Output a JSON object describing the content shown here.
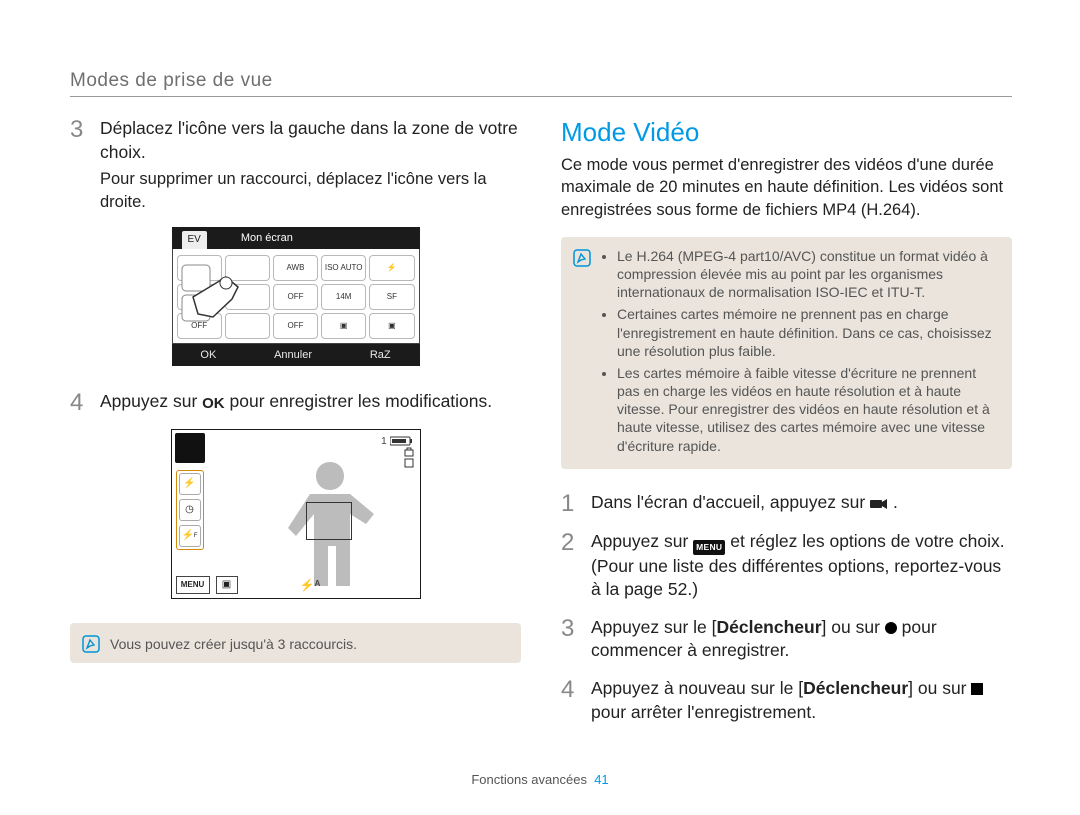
{
  "header": {
    "title": "Modes de prise de vue"
  },
  "left": {
    "step3": {
      "num": "3",
      "text": "Déplacez l'icône vers la gauche dans la zone de votre choix.",
      "sub": "Pour supprimer un raccourci, déplacez l'icône vers la droite."
    },
    "lcd1": {
      "ev_label": "EV",
      "title": "Mon écran",
      "cells": [
        "",
        "",
        "AWB",
        "ISO AUTO",
        "⚡",
        "",
        "",
        "OFF",
        "14M",
        "SF",
        "OFF",
        "",
        "OFF",
        "▣",
        "▣"
      ],
      "ok": "OK",
      "cancel": "Annuler",
      "reset": "RaZ"
    },
    "step4": {
      "num": "4",
      "pre": "Appuyez sur ",
      "ok": "OK",
      "post": " pour enregistrer les modifications."
    },
    "lcd2": {
      "counter": "1",
      "menu": "MENU",
      "flash": "⚡ᴬ"
    },
    "note_bottom": "Vous pouvez créer jusqu'à 3 raccourcis."
  },
  "right": {
    "heading": "Mode Vidéo",
    "desc": "Ce mode vous permet d'enregistrer des vidéos d'une durée maximale de 20 minutes en haute définition. Les vidéos sont enregistrées sous forme de fichiers MP4 (H.264).",
    "notes": [
      "Le H.264 (MPEG-4 part10/AVC) constitue un format vidéo à compression élevée mis au point par les organismes internationaux de normalisation ISO-IEC et ITU-T.",
      "Certaines cartes mémoire ne prennent pas en charge l'enregistrement en haute définition. Dans ce cas, choisissez une résolution plus faible.",
      "Les cartes mémoire à faible vitesse d'écriture ne prennent pas en charge les vidéos en haute résolution et à haute vitesse. Pour enregistrer des vidéos en haute résolution et à haute vitesse, utilisez des cartes mémoire avec une vitesse d'écriture rapide."
    ],
    "step1": {
      "num": "1",
      "pre": "Dans l'écran d'accueil, appuyez sur ",
      "post": "."
    },
    "step2": {
      "num": "2",
      "pre": "Appuyez sur ",
      "menu": "MENU",
      "mid": " et réglez les options de votre choix. (Pour une liste des différentes options, reportez-vous à la page 52.)"
    },
    "step3": {
      "num": "3",
      "pre": "Appuyez sur le [",
      "btn": "Déclencheur",
      "mid": "] ou sur ",
      "post": " pour commencer à enregistrer."
    },
    "step4": {
      "num": "4",
      "pre": "Appuyez à nouveau sur le [",
      "btn": "Déclencheur",
      "mid": "] ou sur ",
      "post": " pour arrêter l'enregistrement."
    }
  },
  "footer": {
    "section": "Fonctions avancées",
    "page": "41"
  }
}
